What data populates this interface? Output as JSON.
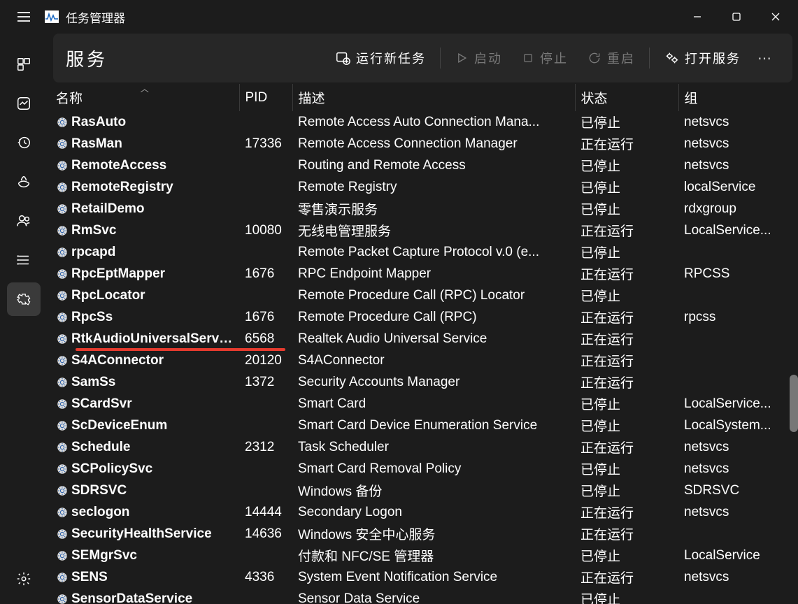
{
  "app": {
    "title": "任务管理器"
  },
  "page": {
    "title": "服务"
  },
  "toolbar": {
    "run": "运行新任务",
    "start": "启动",
    "stop": "停止",
    "restart": "重启",
    "open": "打开服务"
  },
  "columns": {
    "name": "名称",
    "pid": "PID",
    "desc": "描述",
    "status": "状态",
    "group": "组"
  },
  "rows": [
    {
      "name": "RasAuto",
      "pid": "",
      "desc": "Remote Access Auto Connection Mana...",
      "status": "已停止",
      "group": "netsvcs"
    },
    {
      "name": "RasMan",
      "pid": "17336",
      "desc": "Remote Access Connection Manager",
      "status": "正在运行",
      "group": "netsvcs"
    },
    {
      "name": "RemoteAccess",
      "pid": "",
      "desc": "Routing and Remote Access",
      "status": "已停止",
      "group": "netsvcs"
    },
    {
      "name": "RemoteRegistry",
      "pid": "",
      "desc": "Remote Registry",
      "status": "已停止",
      "group": "localService"
    },
    {
      "name": "RetailDemo",
      "pid": "",
      "desc": "零售演示服务",
      "status": "已停止",
      "group": "rdxgroup"
    },
    {
      "name": "RmSvc",
      "pid": "10080",
      "desc": "无线电管理服务",
      "status": "正在运行",
      "group": "LocalService..."
    },
    {
      "name": "rpcapd",
      "pid": "",
      "desc": "Remote Packet Capture Protocol v.0 (e...",
      "status": "已停止",
      "group": ""
    },
    {
      "name": "RpcEptMapper",
      "pid": "1676",
      "desc": "RPC Endpoint Mapper",
      "status": "正在运行",
      "group": "RPCSS"
    },
    {
      "name": "RpcLocator",
      "pid": "",
      "desc": "Remote Procedure Call (RPC) Locator",
      "status": "已停止",
      "group": ""
    },
    {
      "name": "RpcSs",
      "pid": "1676",
      "desc": "Remote Procedure Call (RPC)",
      "status": "正在运行",
      "group": "rpcss"
    },
    {
      "name": "RtkAudioUniversalServi...",
      "pid": "6568",
      "desc": "Realtek Audio Universal Service",
      "status": "正在运行",
      "group": ""
    },
    {
      "name": "S4AConnector",
      "pid": "20120",
      "desc": "S4AConnector",
      "status": "正在运行",
      "group": ""
    },
    {
      "name": "SamSs",
      "pid": "1372",
      "desc": "Security Accounts Manager",
      "status": "正在运行",
      "group": ""
    },
    {
      "name": "SCardSvr",
      "pid": "",
      "desc": "Smart Card",
      "status": "已停止",
      "group": "LocalService..."
    },
    {
      "name": "ScDeviceEnum",
      "pid": "",
      "desc": "Smart Card Device Enumeration Service",
      "status": "已停止",
      "group": "LocalSystem..."
    },
    {
      "name": "Schedule",
      "pid": "2312",
      "desc": "Task Scheduler",
      "status": "正在运行",
      "group": "netsvcs"
    },
    {
      "name": "SCPolicySvc",
      "pid": "",
      "desc": "Smart Card Removal Policy",
      "status": "已停止",
      "group": "netsvcs"
    },
    {
      "name": "SDRSVC",
      "pid": "",
      "desc": "Windows 备份",
      "status": "已停止",
      "group": "SDRSVC"
    },
    {
      "name": "seclogon",
      "pid": "14444",
      "desc": "Secondary Logon",
      "status": "正在运行",
      "group": "netsvcs"
    },
    {
      "name": "SecurityHealthService",
      "pid": "14636",
      "desc": "Windows 安全中心服务",
      "status": "正在运行",
      "group": ""
    },
    {
      "name": "SEMgrSvc",
      "pid": "",
      "desc": "付款和 NFC/SE 管理器",
      "status": "已停止",
      "group": "LocalService"
    },
    {
      "name": "SENS",
      "pid": "4336",
      "desc": "System Event Notification Service",
      "status": "正在运行",
      "group": "netsvcs"
    },
    {
      "name": "SensorDataService",
      "pid": "",
      "desc": "Sensor Data Service",
      "status": "已停止",
      "group": ""
    }
  ]
}
